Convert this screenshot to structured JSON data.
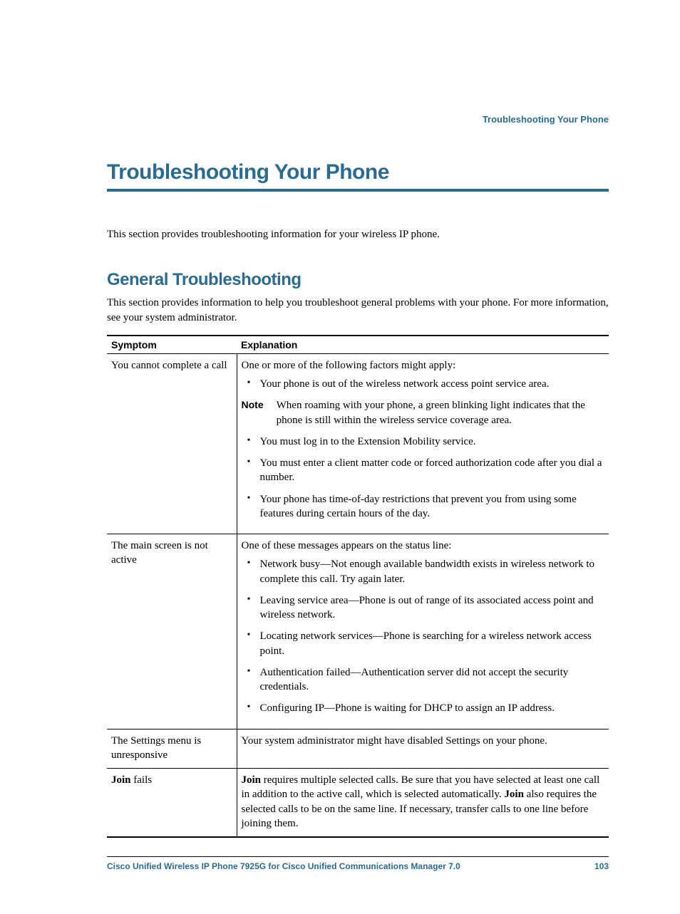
{
  "header": {
    "label": "Troubleshooting Your Phone"
  },
  "title": "Troubleshooting Your Phone",
  "intro": "This section provides troubleshooting information for your wireless IP phone.",
  "section": {
    "title": "General Troubleshooting",
    "intro": "This section provides information to help you troubleshoot general problems with your phone. For more information, see your system administrator."
  },
  "table": {
    "headers": {
      "symptom": "Symptom",
      "explanation": "Explanation"
    },
    "rows": [
      {
        "symptom": "You cannot complete a call",
        "explanation_intro": "One or more of the following factors might apply:",
        "bullets_pre": [
          "Your phone is out of the wireless network access point service area."
        ],
        "note": {
          "label": "Note",
          "text": "When roaming with your phone, a green blinking light indicates that the phone is still within the wireless service coverage area."
        },
        "bullets_post": [
          "You must log in to the Extension Mobility service.",
          "You must enter a client matter code or forced authorization code after you dial a number.",
          "Your phone has time-of-day restrictions that prevent you from using some features during certain hours of the day."
        ]
      },
      {
        "symptom": "The main screen is not active",
        "explanation_intro": "One of these messages appears on the status line:",
        "bullets": [
          "Network busy—Not enough available bandwidth exists in wireless network to complete this call. Try again later.",
          "Leaving service area—Phone is out of range of its associated access point and wireless network.",
          "Locating network services—Phone is searching for a wireless network access point.",
          "Authentication failed—Authentication server did not accept the security credentials.",
          "Configuring IP—Phone is waiting for DHCP to assign an IP address."
        ]
      },
      {
        "symptom": "The Settings menu is unresponsive",
        "explanation_text": "Your system administrator might have disabled Settings on your phone."
      },
      {
        "symptom_bold": "Join",
        "symptom_tail": " fails",
        "explanation_rich": {
          "b1": "Join",
          "t1": " requires multiple selected calls. Be sure that you have selected at least one call in addition to the active call, which is selected automatically. ",
          "b2": "Join",
          "t2": " also requires the selected calls to be on the same line. If necessary, transfer calls to one line before joining them."
        }
      }
    ]
  },
  "footer": {
    "doc": "Cisco Unified Wireless IP Phone 7925G for Cisco Unified Communications Manager 7.0",
    "page": "103"
  }
}
